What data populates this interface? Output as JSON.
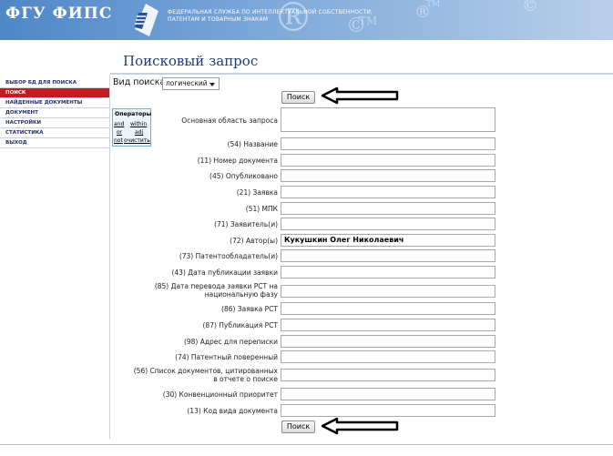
{
  "header": {
    "logo_text": "ФГУ ФИПС",
    "agency_line1": "ФЕДЕРАЛЬНАЯ СЛУЖБА ПО ИНТЕЛЛЕКТУАЛЬНОЙ СОБСТВЕННОСТИ,",
    "agency_line2": "ПАТЕНТАМ И ТОВАРНЫМ ЗНАКАМ",
    "watermark_tm": "TM",
    "watermark_c": "©",
    "watermark_r": "®"
  },
  "sidebar": {
    "items": [
      {
        "label": "ВЫБОР БД ДЛЯ ПОИСКА",
        "active": false
      },
      {
        "label": "ПОИСК",
        "active": true
      },
      {
        "label": "НАЙДЕННЫЕ ДОКУМЕНТЫ",
        "active": false
      },
      {
        "label": "ДОКУМЕНТ",
        "active": false
      },
      {
        "label": "НАСТРОЙКИ",
        "active": false
      },
      {
        "label": "СТАТИСТИКА",
        "active": false
      },
      {
        "label": "ВЫХОД",
        "active": false
      }
    ]
  },
  "main": {
    "title": "Поисковый запрос",
    "search_kind_label": "Вид поиска",
    "search_kind_value": "логический",
    "search_button": "Поиск",
    "operators": {
      "title": "Операторы",
      "and": "and",
      "or": "or",
      "not": "not",
      "within": "within",
      "adj": "adj",
      "clear": "очистить"
    },
    "fields": [
      {
        "label": "Основная область запроса",
        "value": ""
      },
      {
        "label": "(54) Название",
        "value": ""
      },
      {
        "label": "(11) Номер документа",
        "value": ""
      },
      {
        "label": "(45) Опубликовано",
        "value": ""
      },
      {
        "label": "(21) Заявка",
        "value": ""
      },
      {
        "label": "(51) МПК",
        "value": ""
      },
      {
        "label": "(71) Заявитель(и)",
        "value": ""
      },
      {
        "label": "(72) Автор(ы)",
        "value": "Кукушкин Олег Николаевич"
      },
      {
        "label": "(73) Патентообладатель(и)",
        "value": ""
      },
      {
        "label": "(43) Дата публикации заявки",
        "value": ""
      },
      {
        "label_line1": "(85) Дата перевода заявки PCT на",
        "label_line2": "национальную фазу",
        "value": ""
      },
      {
        "label": "(86) Заявка PCT",
        "value": ""
      },
      {
        "label": "(87) Публикация PCT",
        "value": ""
      },
      {
        "label": "(98) Адрес для переписки",
        "value": ""
      },
      {
        "label": "(74) Патентный поверенный",
        "value": ""
      },
      {
        "label_line1": "(56) Список документов, цитированных",
        "label_line2": "в отчете о поиске",
        "value": ""
      },
      {
        "label": "(30) Конвенционный приоритет",
        "value": ""
      },
      {
        "label": "(13) Код вида документа",
        "value": ""
      }
    ]
  }
}
